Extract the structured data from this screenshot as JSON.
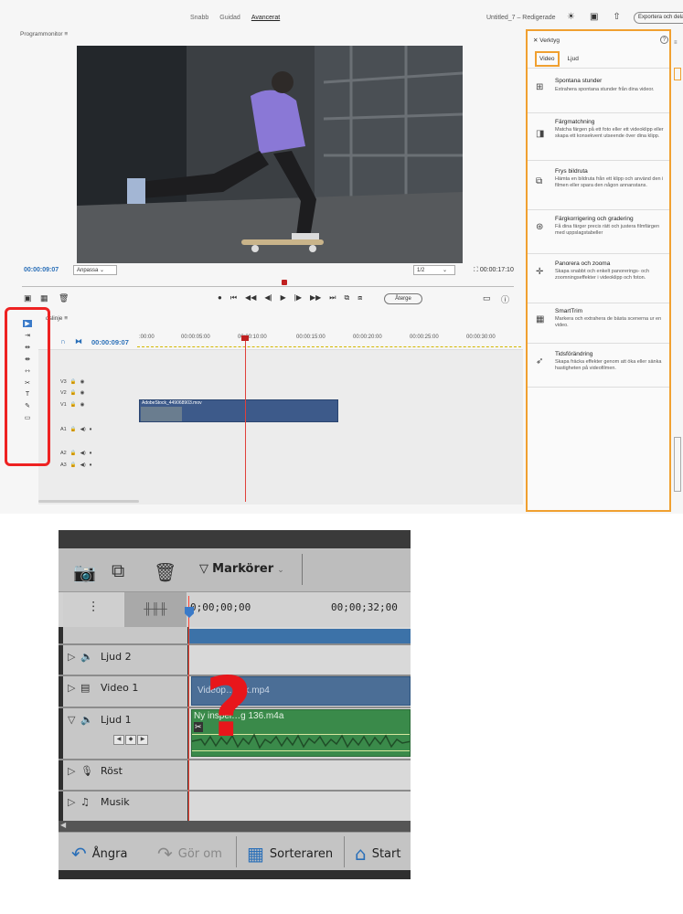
{
  "top": {
    "modes": [
      "Snabb",
      "Guidad",
      "Avancerat"
    ],
    "active_mode": "Avancerat",
    "doc_title": "Untitled_7 – Redigerade",
    "export_label": "Exportera och dela",
    "program_monitor_label": "Programmonitor",
    "timecode_current": "00:00:09:07",
    "fit_label": "Anpassa",
    "quality_label": "1/2",
    "timecode_total": "00:00:17:10",
    "revert_label": "Återge",
    "timeline_label": "dslinje",
    "timeline_tc": "00:00:09:07",
    "ruler": [
      ":00:00",
      "00:00:05:00",
      "00:00:10:00",
      "00:00:15:00",
      "00:00:20:00",
      "00:00:25:00",
      "00:00:30:00"
    ],
    "tracks": [
      "V3",
      "V2",
      "V1",
      "A1",
      "A2",
      "A3"
    ],
    "clip_name": "AdobeStock_449068903.mov",
    "panel": {
      "title": "Verktyg",
      "tab_video": "Video",
      "tab_sound": "Ljud",
      "items": [
        {
          "title": "Spontana stunder",
          "desc": "Extrahera spontana stunder från dina videor.",
          "icon": "moments-icon"
        },
        {
          "title": "Färgmatchning",
          "desc": "Matcha färgen på ett foto eller ett videoklipp eller skapa ett konsekvent utseende över dina klipp.",
          "icon": "color-match-icon"
        },
        {
          "title": "Frys bildruta",
          "desc": "Hämta en bildruta från ett klipp och använd den i filmen eller spara den någon annanstans.",
          "icon": "freeze-frame-icon"
        },
        {
          "title": "Färgkorrigering och gradering",
          "desc": "Få dina färger precis rätt och justera filmfärgen med uppslagstabeller",
          "icon": "color-correction-icon"
        },
        {
          "title": "Panorera och zooma",
          "desc": "Skapa snabbt och enkelt panorerings- och zoomningseffekter i videoklipp och foton.",
          "icon": "pan-zoom-icon"
        },
        {
          "title": "SmartTrim",
          "desc": "Markera och extrahera de bästa scenerna ur en video.",
          "icon": "smart-trim-icon"
        },
        {
          "title": "Tidsförändring",
          "desc": "Skapa fräcka effekter genom att öka eller sänka hastigheten på videofilmen.",
          "icon": "time-remap-icon"
        }
      ]
    }
  },
  "bottom": {
    "markers_label": "Markörer",
    "tc_start": "0;00;00;00",
    "tc_mark": "00;00;32;00",
    "tracks": [
      {
        "name": "Ljud 2",
        "icon": "speaker-icon",
        "glyph": "🔈"
      },
      {
        "name": "Video 1",
        "icon": "film-icon",
        "glyph": "▤"
      },
      {
        "name": "Ljud 1",
        "icon": "speaker-icon",
        "glyph": "🔈"
      },
      {
        "name": "Röst",
        "icon": "mic-icon",
        "glyph": "🎙"
      },
      {
        "name": "Musik",
        "icon": "music-note-icon",
        "glyph": "♫"
      }
    ],
    "video_clip": "Videop…ack.mp4",
    "audio_clip": "Ny inspel…g 136.m4a",
    "question_mark": "?",
    "undo_label": "Ångra",
    "redo_label": "Gör om",
    "organizer_label": "Sorteraren",
    "start_label": "Start"
  },
  "colors": {
    "highlight_red": "#e22222",
    "panel_orange": "#f0a030",
    "timecode_blue": "#2a6fb8"
  }
}
